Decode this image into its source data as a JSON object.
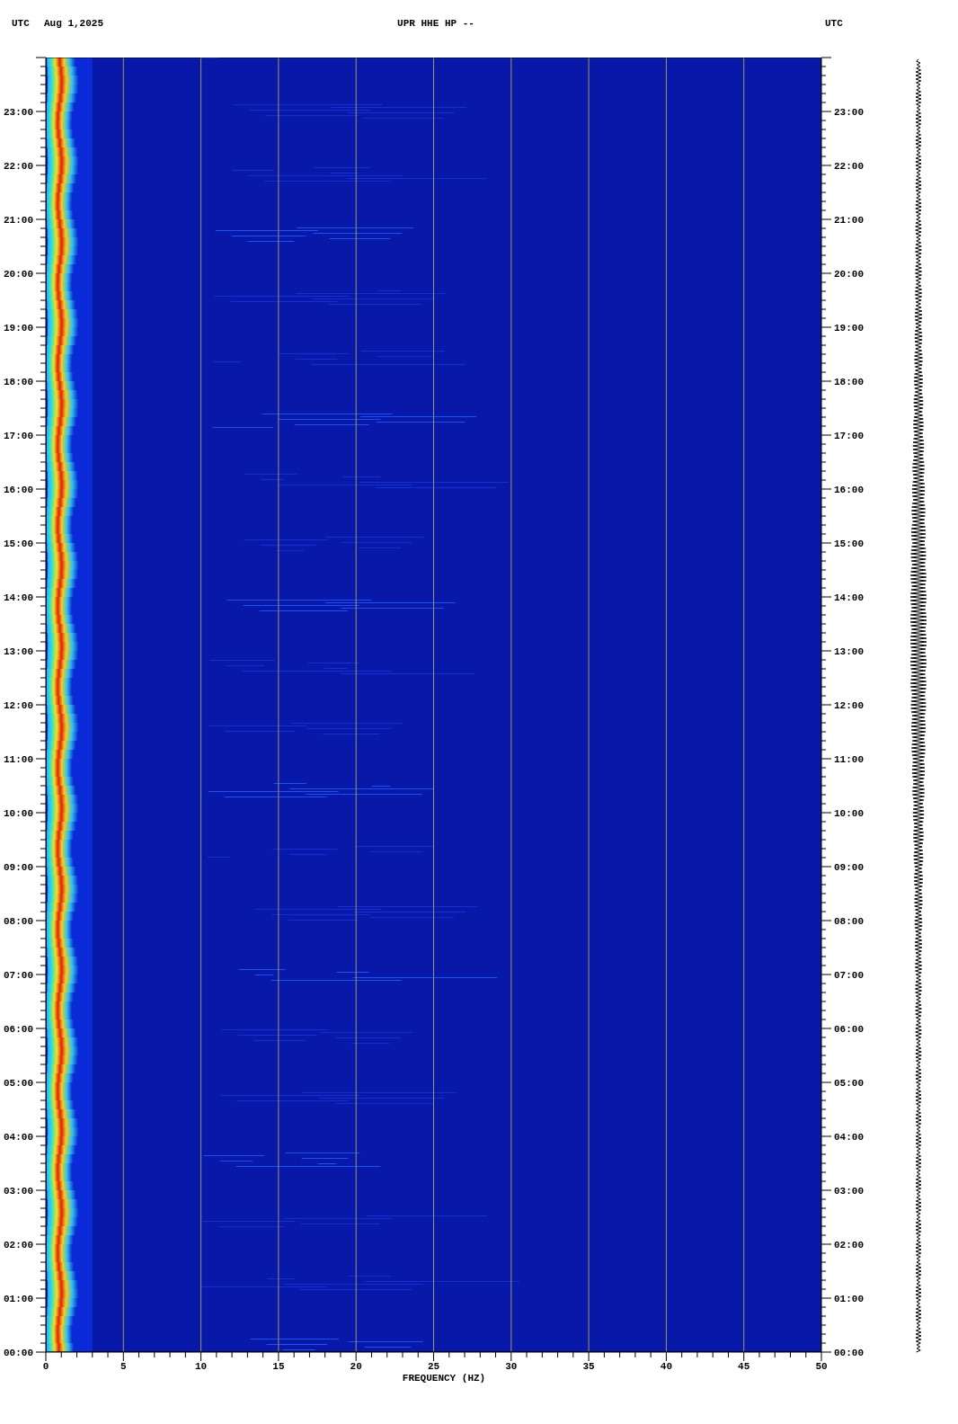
{
  "header": {
    "timezone_left": "UTC",
    "date": "Aug 1,2025",
    "title": "UPR HHE HP --",
    "timezone_right": "UTC"
  },
  "y_ticks_left": [
    "23:00",
    "22:00",
    "21:00",
    "20:00",
    "19:00",
    "18:00",
    "17:00",
    "16:00",
    "15:00",
    "14:00",
    "13:00",
    "12:00",
    "11:00",
    "10:00",
    "09:00",
    "08:00",
    "07:00",
    "06:00",
    "05:00",
    "04:00",
    "03:00",
    "02:00",
    "01:00",
    "00:00"
  ],
  "y_ticks_right": [
    "23:00",
    "22:00",
    "21:00",
    "20:00",
    "19:00",
    "18:00",
    "17:00",
    "16:00",
    "15:00",
    "14:00",
    "13:00",
    "12:00",
    "11:00",
    "10:00",
    "09:00",
    "08:00",
    "07:00",
    "06:00",
    "05:00",
    "04:00",
    "03:00",
    "02:00",
    "01:00",
    "00:00"
  ],
  "x_ticks": [
    "0",
    "5",
    "10",
    "15",
    "20",
    "25",
    "30",
    "35",
    "40",
    "45",
    "50"
  ],
  "x_label": "FREQUENCY (HZ)"
}
